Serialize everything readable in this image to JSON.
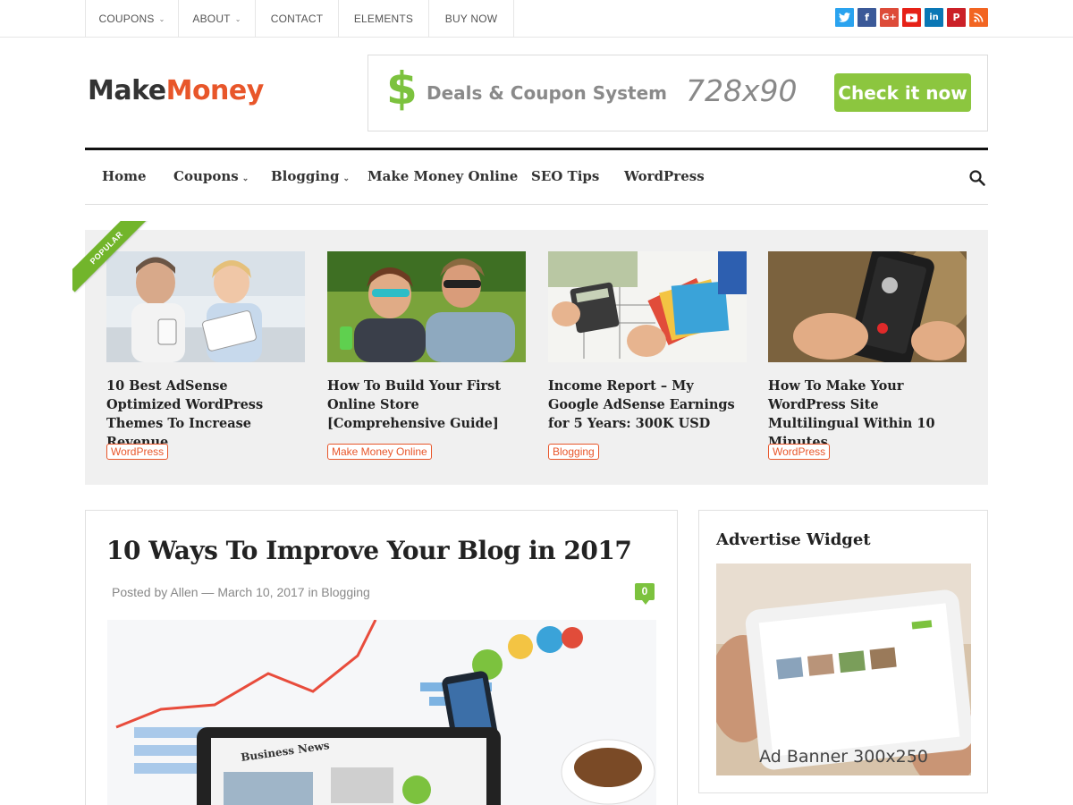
{
  "topbar": {
    "items": [
      {
        "label": "COUPONS",
        "has_dropdown": true
      },
      {
        "label": "ABOUT",
        "has_dropdown": true
      },
      {
        "label": "CONTACT",
        "has_dropdown": false
      },
      {
        "label": "ELEMENTS",
        "has_dropdown": false
      },
      {
        "label": "BUY NOW",
        "has_dropdown": false
      }
    ],
    "social": [
      {
        "name": "twitter-icon",
        "glyph": "t",
        "color": "#2aa3ef"
      },
      {
        "name": "facebook-icon",
        "glyph": "f",
        "color": "#3b5998"
      },
      {
        "name": "google-plus-icon",
        "glyph": "G+",
        "color": "#dd4b39"
      },
      {
        "name": "youtube-icon",
        "glyph": "▶",
        "color": "#e62117"
      },
      {
        "name": "linkedin-icon",
        "glyph": "in",
        "color": "#0a77b5"
      },
      {
        "name": "pinterest-icon",
        "glyph": "P",
        "color": "#cb2027"
      },
      {
        "name": "rss-icon",
        "glyph": "◉",
        "color": "#f26522"
      }
    ]
  },
  "header": {
    "logo_part1": "Make",
    "logo_part2": "Money",
    "ad": {
      "dollar": "$",
      "text": "Deals & Coupon System",
      "size": "728x90",
      "cta": "Check it now"
    }
  },
  "mainnav": {
    "items": [
      {
        "label": "Home",
        "has_dropdown": false
      },
      {
        "label": "Coupons",
        "has_dropdown": true
      },
      {
        "label": "Blogging",
        "has_dropdown": true
      },
      {
        "label": "Make Money Online",
        "has_dropdown": false
      },
      {
        "label": "SEO Tips",
        "has_dropdown": false
      },
      {
        "label": "WordPress",
        "has_dropdown": false
      }
    ]
  },
  "featured": {
    "ribbon": "POPULAR",
    "posts": [
      {
        "title": "10 Best AdSense Optimized WordPress Themes To Increase Revenue",
        "tag": "WordPress"
      },
      {
        "title": "How To Build Your First Online Store [Comprehensive Guide]",
        "tag": "Make Money Online"
      },
      {
        "title": "Income Report – My Google AdSense Earnings for 5 Years: 300K USD",
        "tag": "Blogging"
      },
      {
        "title": "How To Make Your WordPress Site Multilingual Within 10 Minutes",
        "tag": "WordPress"
      }
    ]
  },
  "post": {
    "title": "10 Ways To Improve Your Blog in 2017",
    "meta_prefix": "Posted by",
    "author": "Allen",
    "date": "March 10, 2017",
    "meta_in": "in",
    "category": "Blogging",
    "comments": "0"
  },
  "sidebar": {
    "widget_title": "Advertise Widget",
    "ad_label": "Ad Banner 300x250"
  },
  "colors": {
    "accent": "#e8562a",
    "green": "#7cc23e"
  }
}
